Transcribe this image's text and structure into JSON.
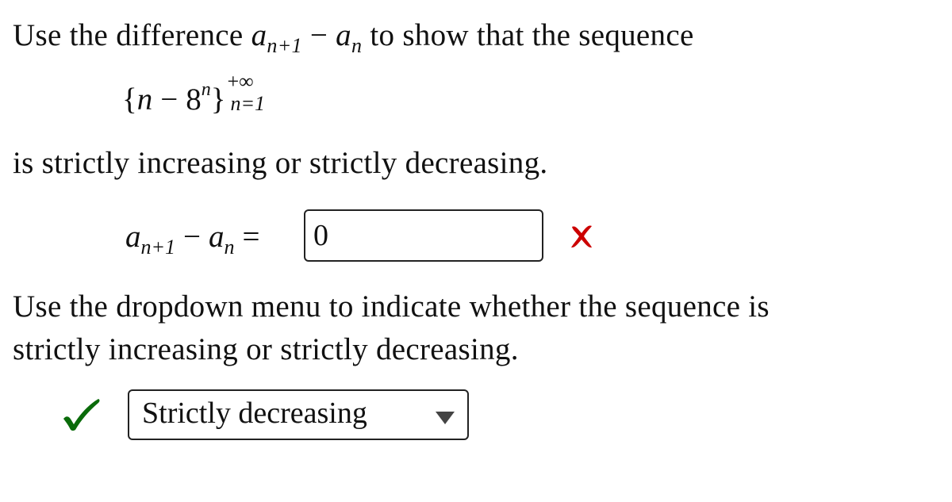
{
  "question": {
    "intro_prefix": "Use the difference",
    "intro_suffix": "to show that the sequence",
    "difference_expr": {
      "term1_base": "a",
      "term1_sub": "n+1",
      "operator": "−",
      "term2_base": "a",
      "term2_sub": "n"
    },
    "sequence": {
      "open_brace": "{",
      "var": "n",
      "minus": "−",
      "base": "8",
      "exponent": "n",
      "close_brace": "}",
      "upper_limit": "+∞",
      "lower_limit": "n=1"
    },
    "line2": "is strictly increasing or strictly decreasing.",
    "line3": "Use the dropdown menu to indicate whether the sequence is",
    "line4": "strictly increasing or strictly decreasing."
  },
  "answer_row": {
    "lhs_term1_base": "a",
    "lhs_term1_sub": "n+1",
    "lhs_operator": "−",
    "lhs_term2_base": "a",
    "lhs_term2_sub": "n",
    "equals": "=",
    "input_value": "0",
    "status": "incorrect",
    "status_icon": "x-mark-icon",
    "status_color": "#cc0000"
  },
  "dropdown_row": {
    "selected": "Strictly decreasing",
    "status": "correct",
    "status_icon": "checkmark-icon",
    "status_color": "#0a6b0a"
  }
}
